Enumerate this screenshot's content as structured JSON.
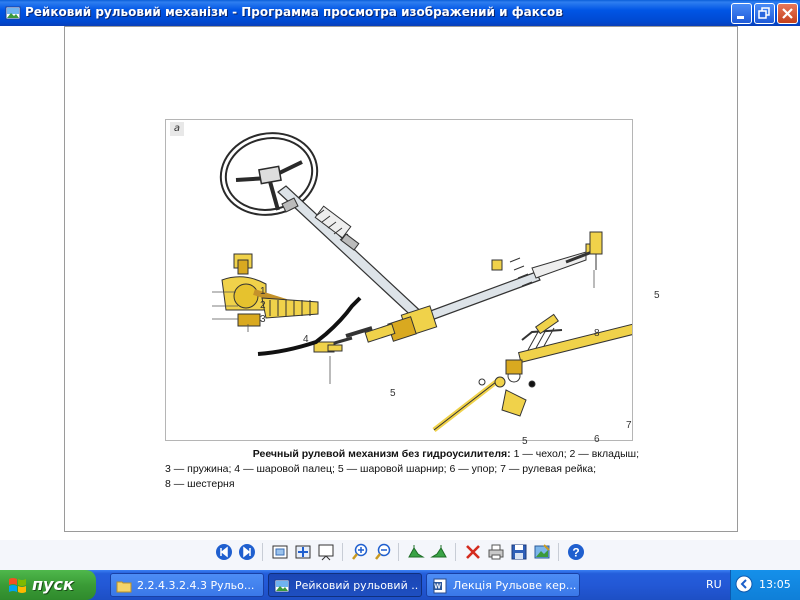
{
  "window": {
    "title": "Рейковий рульовий механізм - Программа просмотра изображений и факсов"
  },
  "figure": {
    "panel_letter": "а",
    "callouts": {
      "c1": "1",
      "c2": "2",
      "c3": "3",
      "c4": "4",
      "c5_left": "5",
      "c5_right": "5",
      "c5_bottom": "5",
      "c6": "6",
      "c7": "7",
      "c8": "8"
    },
    "caption": {
      "title": "Реечный рулевой механизм без гидроусилителя:",
      "line1_rest": " 1 — чехол; 2 — вкладыш;",
      "line2": "3 — пружина; 4 — шаровой палец; 5 — шаровой шарнир; 6 — упор; 7 — рулевая рейка;",
      "line3": "8 — шестерня"
    }
  },
  "toolbar": {
    "buttons": [
      "previous-image",
      "next-image",
      "best-fit",
      "actual-size",
      "slideshow",
      "zoom-in",
      "zoom-out",
      "rotate-clockwise",
      "rotate-counterclockwise",
      "delete",
      "print",
      "save-as",
      "open-for-editing",
      "help"
    ]
  },
  "taskbar": {
    "start_label": "пуск",
    "tasks": [
      {
        "label": "2.2.4.3.2.4.3 Рульо...",
        "icon": "folder-icon"
      },
      {
        "label": "Рейковий рульовий ...",
        "icon": "image-viewer-icon"
      },
      {
        "label": "Лекція Рульове кер...",
        "icon": "word-document-icon"
      }
    ],
    "language": "RU",
    "clock": "13:05"
  },
  "colors": {
    "titlebar": "#0055e5",
    "taskbar": "#245edb",
    "start_button": "#3a9b36",
    "tray": "#0f7fd8",
    "drawing_yellow": "#f0d24a"
  }
}
